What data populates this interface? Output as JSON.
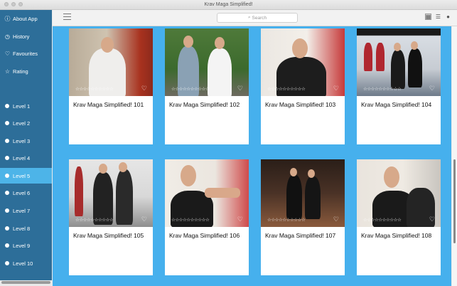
{
  "window": {
    "title": "Krav Maga Simplified!"
  },
  "sidebar": {
    "top_items": [
      {
        "label": "About App",
        "icon": "info-icon"
      },
      {
        "label": "History",
        "icon": "clock-icon"
      },
      {
        "label": "Favourites",
        "icon": "heart-icon"
      },
      {
        "label": "Rating",
        "icon": "star-icon"
      }
    ],
    "levels": [
      {
        "label": "Level 1"
      },
      {
        "label": "Level 2"
      },
      {
        "label": "Level 3"
      },
      {
        "label": "Level 4"
      },
      {
        "label": "Level 5",
        "active": true
      },
      {
        "label": "Level 6"
      },
      {
        "label": "Level 7"
      },
      {
        "label": "Level 8"
      },
      {
        "label": "Level 9"
      },
      {
        "label": "Level 10"
      }
    ]
  },
  "toolbar": {
    "search_placeholder": "Search",
    "views": [
      "grid-view-icon",
      "list-view-icon",
      "info-icon"
    ]
  },
  "videos": [
    {
      "title": "Krav Maga Simplified! 101",
      "rating_stars": "☆☆☆☆☆☆☆☆☆☆"
    },
    {
      "title": "Krav Maga Simplified! 102",
      "rating_stars": "☆☆☆☆☆☆☆☆☆☆"
    },
    {
      "title": "Krav Maga Simplified! 103",
      "rating_stars": "☆☆☆☆☆☆☆☆☆☆"
    },
    {
      "title": "Krav Maga Simplified! 104",
      "rating_stars": "☆☆☆☆☆☆☆☆☆☆"
    },
    {
      "title": "Krav Maga Simplified! 105",
      "rating_stars": "☆☆☆☆☆☆☆☆☆☆"
    },
    {
      "title": "Krav Maga Simplified! 106",
      "rating_stars": "☆☆☆☆☆☆☆☆☆☆"
    },
    {
      "title": "Krav Maga Simplified! 107",
      "rating_stars": "☆☆☆☆☆☆☆☆☆☆"
    },
    {
      "title": "Krav Maga Simplified! 108",
      "rating_stars": "☆☆☆☆☆☆☆☆☆☆"
    }
  ],
  "colors": {
    "sidebar": "#2d6e99",
    "active": "#4db4e8",
    "content_bg": "#46b0ed"
  }
}
